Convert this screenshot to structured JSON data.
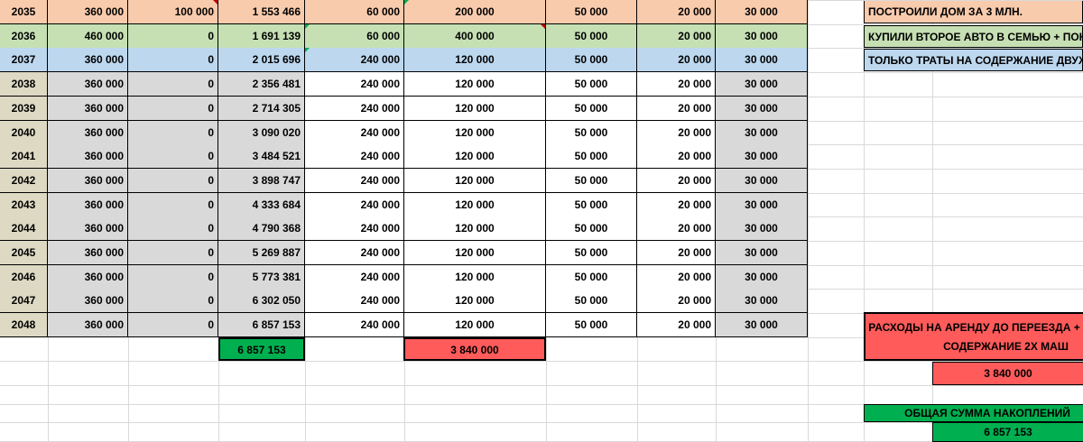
{
  "rows": [
    {
      "year": "2035",
      "c1": "360 000",
      "c2": "100 000",
      "c3": "1 553 466",
      "c4": "60 000",
      "c5": "200 000",
      "c6": "50 000",
      "c7": "20 000",
      "c8": "30 000"
    },
    {
      "year": "2036",
      "c1": "460 000",
      "c2": "0",
      "c3": "1 691 139",
      "c4": "60 000",
      "c5": "400 000",
      "c6": "50 000",
      "c7": "20 000",
      "c8": "30 000"
    },
    {
      "year": "2037",
      "c1": "360 000",
      "c2": "0",
      "c3": "2 015 696",
      "c4": "240 000",
      "c5": "120 000",
      "c6": "50 000",
      "c7": "20 000",
      "c8": "30 000"
    },
    {
      "year": "2038",
      "c1": "360 000",
      "c2": "0",
      "c3": "2 356 481",
      "c4": "240 000",
      "c5": "120 000",
      "c6": "50 000",
      "c7": "20 000",
      "c8": "30 000"
    },
    {
      "year": "2039",
      "c1": "360 000",
      "c2": "0",
      "c3": "2 714 305",
      "c4": "240 000",
      "c5": "120 000",
      "c6": "50 000",
      "c7": "20 000",
      "c8": "30 000"
    },
    {
      "year": "2040",
      "c1": "360 000",
      "c2": "0",
      "c3": "3 090 020",
      "c4": "240 000",
      "c5": "120 000",
      "c6": "50 000",
      "c7": "20 000",
      "c8": "30 000"
    },
    {
      "year": "2041",
      "c1": "360 000",
      "c2": "0",
      "c3": "3 484 521",
      "c4": "240 000",
      "c5": "120 000",
      "c6": "50 000",
      "c7": "20 000",
      "c8": "30 000"
    },
    {
      "year": "2042",
      "c1": "360 000",
      "c2": "0",
      "c3": "3 898 747",
      "c4": "240 000",
      "c5": "120 000",
      "c6": "50 000",
      "c7": "20 000",
      "c8": "30 000"
    },
    {
      "year": "2043",
      "c1": "360 000",
      "c2": "0",
      "c3": "4 333 684",
      "c4": "240 000",
      "c5": "120 000",
      "c6": "50 000",
      "c7": "20 000",
      "c8": "30 000"
    },
    {
      "year": "2044",
      "c1": "360 000",
      "c2": "0",
      "c3": "4 790 368",
      "c4": "240 000",
      "c5": "120 000",
      "c6": "50 000",
      "c7": "20 000",
      "c8": "30 000"
    },
    {
      "year": "2045",
      "c1": "360 000",
      "c2": "0",
      "c3": "5 269 887",
      "c4": "240 000",
      "c5": "120 000",
      "c6": "50 000",
      "c7": "20 000",
      "c8": "30 000"
    },
    {
      "year": "2046",
      "c1": "360 000",
      "c2": "0",
      "c3": "5 773 381",
      "c4": "240 000",
      "c5": "120 000",
      "c6": "50 000",
      "c7": "20 000",
      "c8": "30 000"
    },
    {
      "year": "2047",
      "c1": "360 000",
      "c2": "0",
      "c3": "6 302 050",
      "c4": "240 000",
      "c5": "120 000",
      "c6": "50 000",
      "c7": "20 000",
      "c8": "30 000"
    },
    {
      "year": "2048",
      "c1": "360 000",
      "c2": "0",
      "c3": "6 857 153",
      "c4": "240 000",
      "c5": "120 000",
      "c6": "50 000",
      "c7": "20 000",
      "c8": "30 000"
    }
  ],
  "totals": {
    "savings": "6 857 153",
    "rent": "3 840 000"
  },
  "notes": {
    "n1": "ПОСТРОИЛИ ДОМ ЗА 3 МЛН.",
    "n2": "КУПИЛИ ВТОРОЕ АВТО В СЕМЬЮ + ПОКУП",
    "n3": "ТОЛЬКО ТРАТЫ НА СОДЕРЖАНИЕ ДВУХ А"
  },
  "summary": {
    "rent_label_line1": "РАСХОДЫ НА АРЕНДУ ДО ПЕРЕЕЗДА +",
    "rent_label_line2": "СОДЕРЖАНИЕ 2Х МАШ",
    "rent_value": "3 840 000",
    "savings_label": "ОБЩАЯ СУММА НАКОПЛЕНИЙ",
    "savings_value": "6 857 153"
  },
  "colors": {
    "peach": "#f8cbad",
    "green": "#c6e0b4",
    "blue": "#bdd7ee",
    "tan": "#ddd9c3",
    "gray": "#d9d9d9",
    "red": "#ff5b5b",
    "brightgreen": "#00b050"
  }
}
